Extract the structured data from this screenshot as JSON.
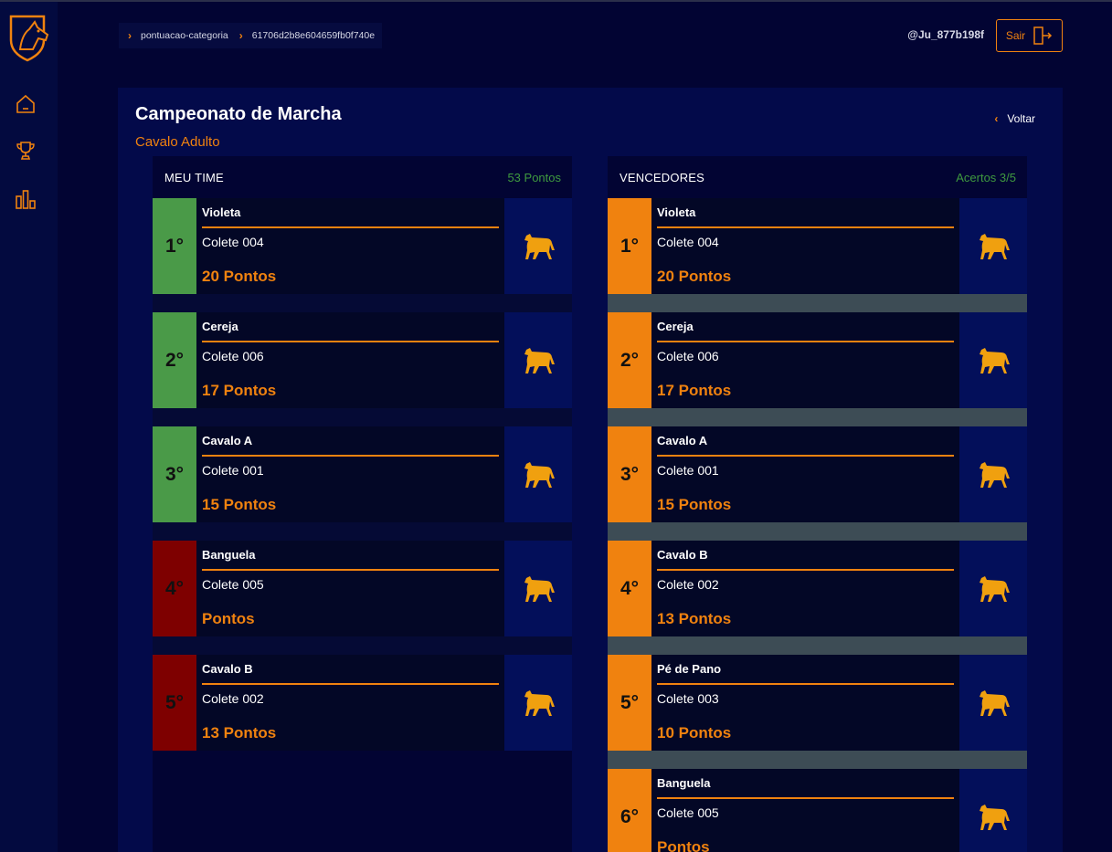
{
  "breadcrumb": [
    "pontuacao-categoria",
    "61706d2b8e604659fb0f740e"
  ],
  "user": {
    "name": "@Ju_877b198f",
    "logout_label": "Sair"
  },
  "page": {
    "title": "Campeonato de Marcha",
    "subtitle": "Cavalo Adulto",
    "back_label": "Voltar"
  },
  "my_team": {
    "label": "MEU TIME",
    "score": "53 Pontos",
    "rows": [
      {
        "rank": "1°",
        "name": "Violeta",
        "colete": "Colete 004",
        "points": "20 Pontos",
        "status": "green"
      },
      {
        "rank": "2°",
        "name": "Cereja",
        "colete": "Colete 006",
        "points": "17 Pontos",
        "status": "green"
      },
      {
        "rank": "3°",
        "name": "Cavalo A",
        "colete": "Colete 001",
        "points": "15 Pontos",
        "status": "green"
      },
      {
        "rank": "4°",
        "name": "Banguela",
        "colete": "Colete 005",
        "points": "Pontos",
        "status": "red"
      },
      {
        "rank": "5°",
        "name": "Cavalo B",
        "colete": "Colete 002",
        "points": "13 Pontos",
        "status": "red"
      }
    ]
  },
  "winners": {
    "label": "VENCEDORES",
    "score": "Acertos 3/5",
    "rows": [
      {
        "rank": "1°",
        "name": "Violeta",
        "colete": "Colete 004",
        "points": "20 Pontos"
      },
      {
        "rank": "2°",
        "name": "Cereja",
        "colete": "Colete 006",
        "points": "17 Pontos"
      },
      {
        "rank": "3°",
        "name": "Cavalo A",
        "colete": "Colete 001",
        "points": "15 Pontos"
      },
      {
        "rank": "4°",
        "name": "Cavalo B",
        "colete": "Colete 002",
        "points": "13 Pontos"
      },
      {
        "rank": "5°",
        "name": "Pé de Pano",
        "colete": "Colete 003",
        "points": "10 Pontos"
      },
      {
        "rank": "6°",
        "name": "Banguela",
        "colete": "Colete 005",
        "points": "Pontos"
      }
    ]
  },
  "colors": {
    "accent": "#f0820f",
    "correct": "#4a9a48",
    "wrong": "#7e0000",
    "background": "#020433"
  },
  "icons": [
    "logo-horse-shield",
    "home-icon",
    "trophy-icon",
    "bar-chart-icon",
    "logout-door-icon",
    "horse-icon"
  ]
}
